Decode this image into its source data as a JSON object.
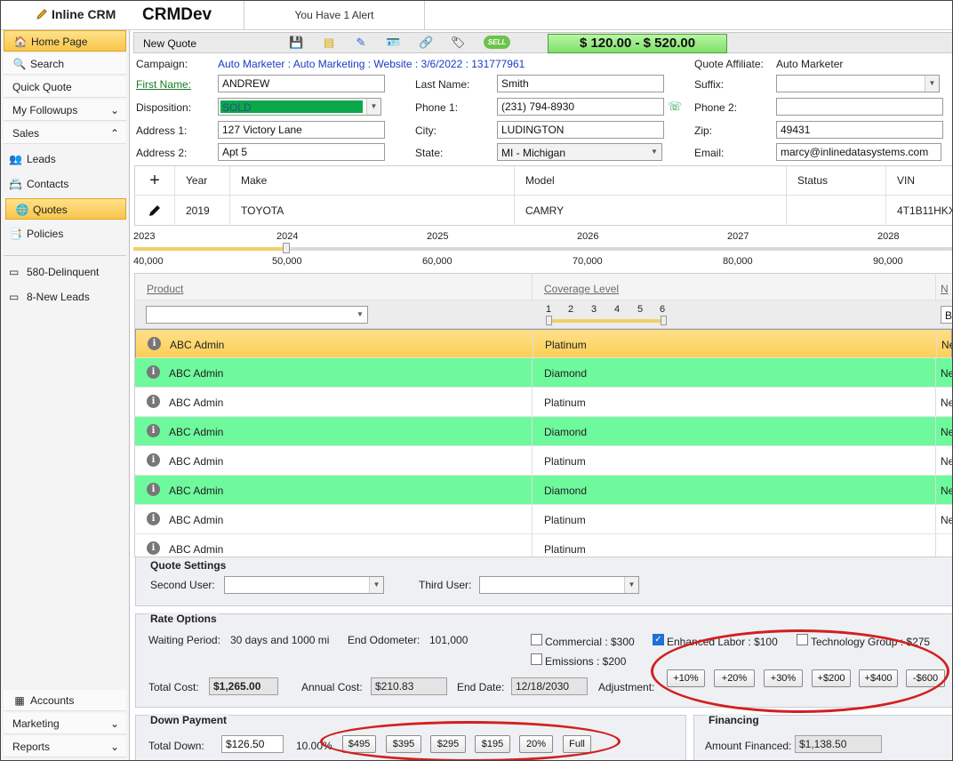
{
  "header": {
    "logo": "Inline CRM",
    "app_name": "CRMDev",
    "alert": "You Have 1 Alert"
  },
  "sidebar": {
    "items": [
      {
        "label": "Home Page",
        "icon": "home-icon"
      },
      {
        "label": "Search",
        "icon": "search-icon"
      },
      {
        "label": "Quick Quote"
      },
      {
        "label": "My Followups"
      },
      {
        "label": "Sales"
      },
      {
        "label": "Leads",
        "icon": "leads-icon"
      },
      {
        "label": "Contacts",
        "icon": "contacts-icon"
      },
      {
        "label": "Quotes",
        "icon": "quotes-icon"
      },
      {
        "label": "Policies",
        "icon": "policies-icon"
      },
      {
        "label": "580-Delinquent",
        "icon": "list-icon"
      },
      {
        "label": "8-New Leads",
        "icon": "list-icon"
      }
    ],
    "bottom": [
      {
        "label": "Accounts",
        "icon": "accounts-icon"
      },
      {
        "label": "Marketing"
      },
      {
        "label": "Reports"
      }
    ]
  },
  "toolbar": {
    "title": "New Quote",
    "sell_label": "SELL",
    "price_range": "$ 120.00 - $ 520.00"
  },
  "form": {
    "campaign_label": "Campaign:",
    "campaign_value": "Auto Marketer : Auto Marketing : Website : 3/6/2022 : 131777961",
    "affiliate_label": "Quote Affiliate:",
    "affiliate_value": "Auto Marketer",
    "first_name_label": "First Name:",
    "first_name": "ANDREW",
    "last_name_label": "Last Name:",
    "last_name": "Smith",
    "suffix_label": "Suffix:",
    "suffix": "",
    "disposition_label": "Disposition:",
    "disposition": "SOLD",
    "phone1_label": "Phone 1:",
    "phone1": "(231) 794-8930",
    "phone2_label": "Phone 2:",
    "phone2": "",
    "address1_label": "Address 1:",
    "address1": "127 Victory Lane",
    "city_label": "City:",
    "city": "LUDINGTON",
    "zip_label": "Zip:",
    "zip": "49431",
    "address2_label": "Address 2:",
    "address2": "Apt 5",
    "state_label": "State:",
    "state": "MI - Michigan",
    "email_label": "Email:",
    "email": "marcy@inlinedatasystems.com"
  },
  "vehicles": {
    "columns": [
      "Year",
      "Make",
      "Model",
      "Status",
      "VIN"
    ],
    "rows": [
      {
        "year": "2019",
        "make": "TOYOTA",
        "model": "CAMRY",
        "status": "",
        "vin": "4T1B11HKX"
      }
    ]
  },
  "timeline": {
    "years": [
      "2023",
      "2024",
      "2025",
      "2026",
      "2027",
      "2028"
    ],
    "miles": [
      "40,000",
      "50,000",
      "60,000",
      "70,000",
      "80,000",
      "90,000"
    ]
  },
  "products": {
    "columns": [
      "Product",
      "Coverage Level",
      "N"
    ],
    "coverage_scale": [
      "1",
      "2",
      "3",
      "4",
      "5",
      "6"
    ],
    "filter_third": "B",
    "rows": [
      {
        "product": "ABC Admin",
        "coverage": "Platinum",
        "n": "Ne"
      },
      {
        "product": "ABC Admin",
        "coverage": "Diamond",
        "n": "Ne"
      },
      {
        "product": "ABC Admin",
        "coverage": "Platinum",
        "n": "Ne"
      },
      {
        "product": "ABC Admin",
        "coverage": "Diamond",
        "n": "Ne"
      },
      {
        "product": "ABC Admin",
        "coverage": "Platinum",
        "n": "Ne"
      },
      {
        "product": "ABC Admin",
        "coverage": "Diamond",
        "n": "Ne"
      },
      {
        "product": "ABC Admin",
        "coverage": "Platinum",
        "n": "Ne"
      },
      {
        "product": "ABC Admin",
        "coverage": "Platinum",
        "n": ""
      }
    ]
  },
  "quote_settings": {
    "title": "Quote Settings",
    "second_user_label": "Second User:",
    "third_user_label": "Third User:"
  },
  "rate_options": {
    "title": "Rate Options",
    "waiting_period_label": "Waiting Period:",
    "waiting_period": "30 days and 1000 mi",
    "end_odometer_label": "End Odometer:",
    "end_odometer": "101,000",
    "commercial": "Commercial : $300",
    "enhanced_labor": "Enhanced Labor : $100",
    "technology_group": "Technology Group : $275",
    "emissions": "Emissions : $200",
    "total_cost_label": "Total Cost:",
    "total_cost": "$1,265.00",
    "annual_cost_label": "Annual Cost:",
    "annual_cost": "$210.83",
    "end_date_label": "End Date:",
    "end_date": "12/18/2030",
    "adjustment_label": "Adjustment:",
    "adjustments": [
      "+10%",
      "+20%",
      "+30%",
      "+$200",
      "+$400",
      "-$600"
    ]
  },
  "down_payment": {
    "title": "Down Payment",
    "total_down_label": "Total Down:",
    "total_down": "$126.50",
    "percent": "10.00%",
    "buttons": [
      "$495",
      "$395",
      "$295",
      "$195",
      "20%",
      "Full"
    ]
  },
  "financing": {
    "title": "Financing",
    "amount_label": "Amount Financed:",
    "amount": "$1,138.50"
  },
  "colors": {
    "accent_green": "#6ef99c",
    "selected_row": "#fbcf58",
    "sold_green": "#0aa84a",
    "highlight_red": "#d21f1f"
  }
}
